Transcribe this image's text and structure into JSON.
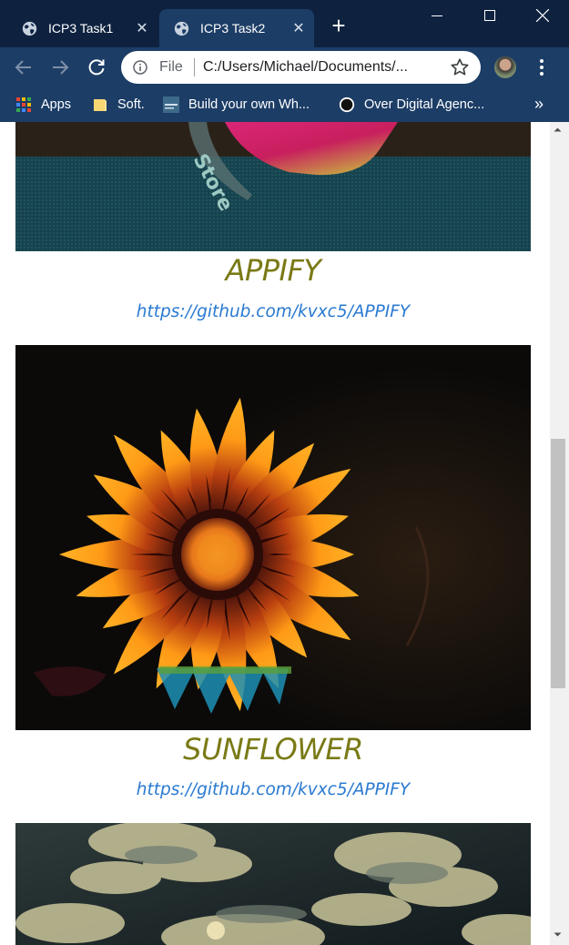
{
  "browser": {
    "tabs": [
      {
        "title": "ICP3 Task1",
        "close": "✕",
        "active": false
      },
      {
        "title": "ICP3 Task2",
        "close": "✕",
        "active": true
      }
    ],
    "new_tab": "+",
    "address": {
      "scheme": "File",
      "url": "C:/Users/Michael/Documents/..."
    },
    "bookmarks": [
      {
        "label": "Apps",
        "icon": "apps-grid-icon"
      },
      {
        "label": "Soft.",
        "icon": "folder-icon"
      },
      {
        "label": "Build your own Wh...",
        "icon": "site-thumbnail-icon"
      },
      {
        "label": "Over Digital Agenc...",
        "icon": "circle-logo-icon"
      }
    ],
    "bookmarks_more": "»"
  },
  "projects": [
    {
      "title": "APPIFY",
      "link": "https://github.com/kvxc5/APPIFY",
      "image": "app-store-photo"
    },
    {
      "title": "SUNFLOWER",
      "link": "https://github.com/kvxc5/APPIFY",
      "image": "orange-gazania-flower-photo"
    },
    {
      "image": "cloudy-sky-photo"
    }
  ],
  "colors": {
    "titlebar": "#0e2240",
    "toolbar": "#1c3d66",
    "project_title": "#7a7a16",
    "project_link": "#2a7ad1"
  }
}
